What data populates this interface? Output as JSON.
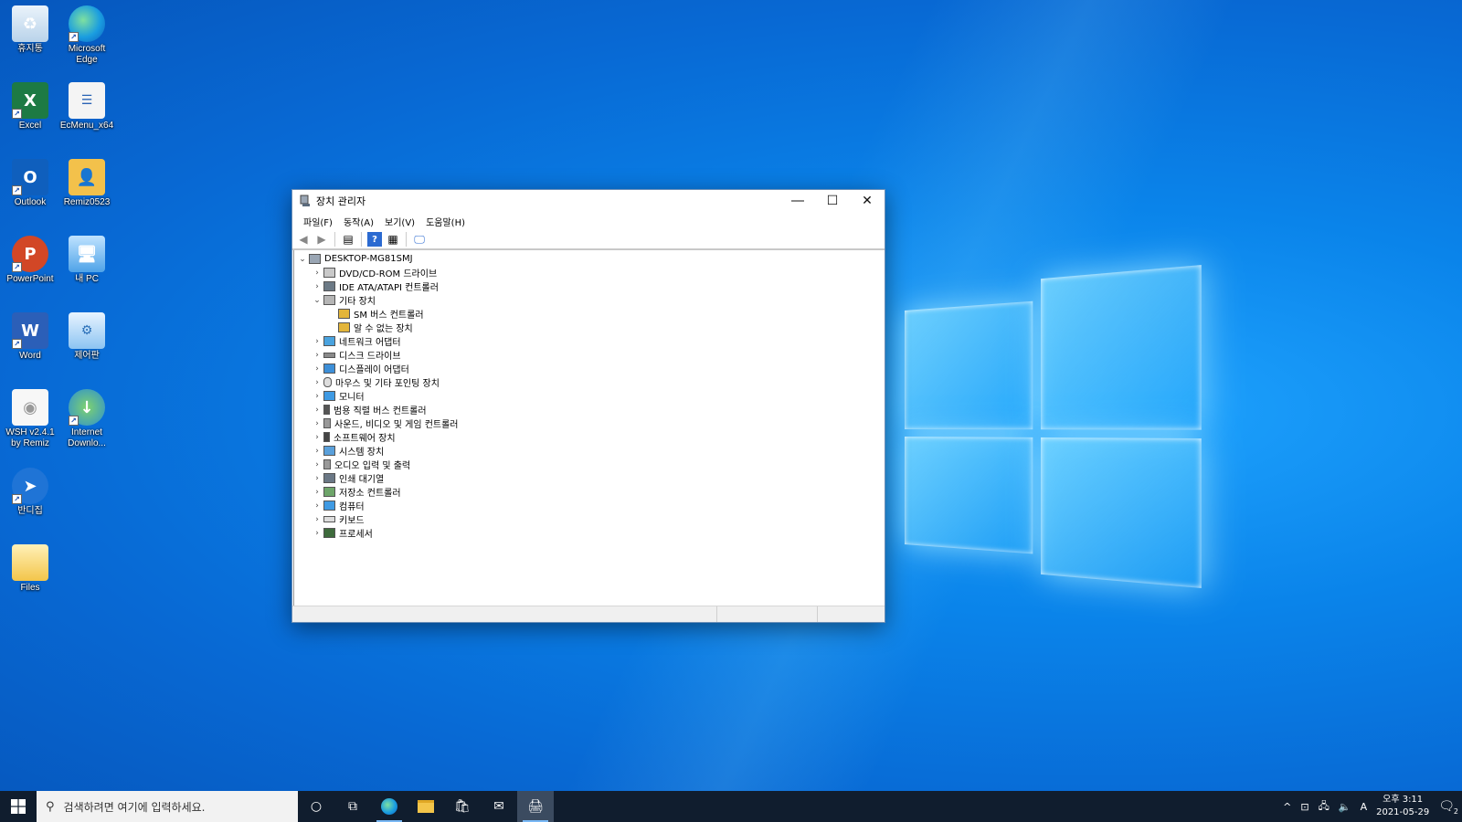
{
  "desktop": {
    "icons": [
      {
        "label": "휴지통",
        "icon": "recycle-bin-icon"
      },
      {
        "label": "Microsoft Edge",
        "icon": "edge-icon"
      },
      {
        "label": "Excel",
        "icon": "excel-icon"
      },
      {
        "label": "EcMenu_x64",
        "icon": "ecmenu-icon"
      },
      {
        "label": "Outlook",
        "icon": "outlook-icon"
      },
      {
        "label": "Remiz0523",
        "icon": "user-folder-icon"
      },
      {
        "label": "PowerPoint",
        "icon": "powerpoint-icon"
      },
      {
        "label": "내 PC",
        "icon": "this-pc-icon"
      },
      {
        "label": "Word",
        "icon": "word-icon"
      },
      {
        "label": "제어판",
        "icon": "control-panel-icon"
      },
      {
        "label": "WSH v2.4.1 by Remiz",
        "icon": "wsh-icon"
      },
      {
        "label": "Internet Downlo...",
        "icon": "internet-download-icon"
      },
      {
        "label": "반디집",
        "icon": "bandizip-icon"
      },
      {
        "label": "Files",
        "icon": "files-folder-icon"
      }
    ]
  },
  "window": {
    "title": "장치 관리자",
    "menu": [
      "파일(F)",
      "동작(A)",
      "보기(V)",
      "도움말(H)"
    ],
    "tree": {
      "root": "DESKTOP-MG81SMJ",
      "items": [
        {
          "label": "DVD/CD-ROM 드라이브"
        },
        {
          "label": "IDE ATA/ATAPI 컨트롤러"
        },
        {
          "label": "기타 장치"
        },
        {
          "label": "SM 버스 컨트롤러"
        },
        {
          "label": "알 수 없는 장치"
        },
        {
          "label": "네트워크 어댑터"
        },
        {
          "label": "디스크 드라이브"
        },
        {
          "label": "디스플레이 어댑터"
        },
        {
          "label": "마우스 및 기타 포인팅 장치"
        },
        {
          "label": "모니터"
        },
        {
          "label": "범용 직렬 버스 컨트롤러"
        },
        {
          "label": "사운드, 비디오 및 게임 컨트롤러"
        },
        {
          "label": "소프트웨어 장치"
        },
        {
          "label": "시스템 장치"
        },
        {
          "label": "오디오 입력 및 출력"
        },
        {
          "label": "인쇄 대기열"
        },
        {
          "label": "저장소 컨트롤러"
        },
        {
          "label": "컴퓨터"
        },
        {
          "label": "키보드"
        },
        {
          "label": "프로세서"
        }
      ]
    }
  },
  "taskbar": {
    "search_placeholder": "검색하려면 여기에 입력하세요.",
    "clock_time": "오후 3:11",
    "clock_date": "2021-05-29",
    "ime": "A",
    "notifications": "2"
  }
}
